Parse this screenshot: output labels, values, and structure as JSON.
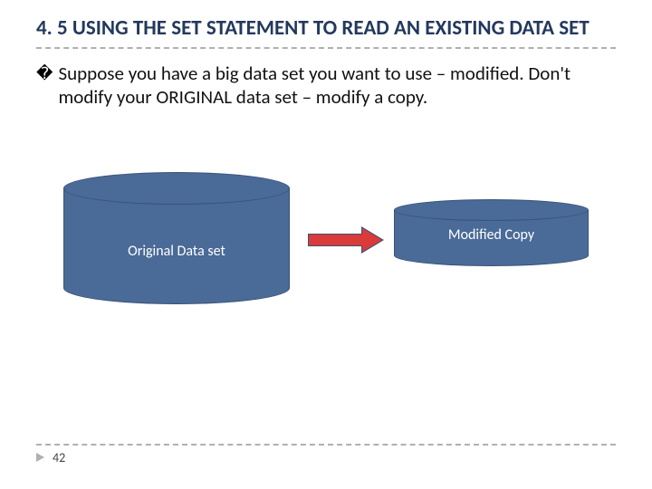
{
  "title": "4. 5 USING THE SET STATEMENT TO READ AN EXISTING DATA SET",
  "bullet_glyph": "�",
  "body": "Suppose you have a big data set you want to use – modified. Don't modify your ORIGINAL data set – modify a copy.",
  "diagram": {
    "left_label": "Original Data set",
    "right_label": "Modified Copy"
  },
  "page_number": "42"
}
